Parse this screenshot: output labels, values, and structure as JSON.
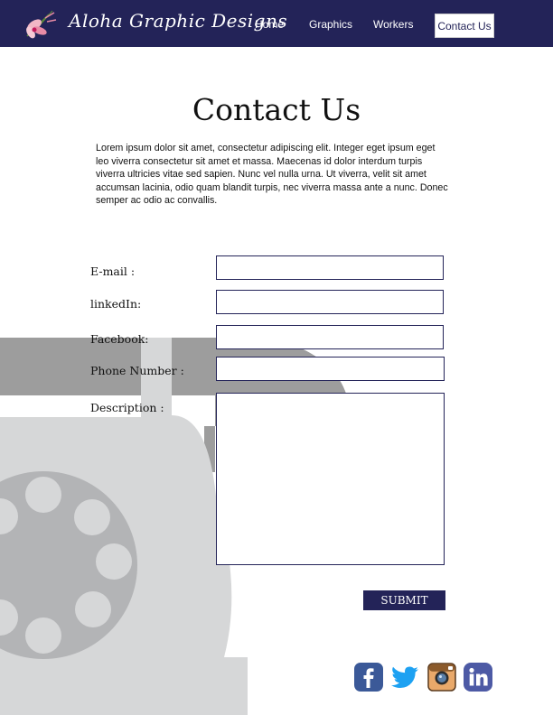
{
  "brand": {
    "name": "Aloha Graphic Designs"
  },
  "nav": {
    "items": [
      {
        "label": "Home"
      },
      {
        "label": "Graphics"
      },
      {
        "label": "Workers"
      },
      {
        "label": "Contact Us",
        "active": true
      }
    ]
  },
  "page": {
    "title": "Contact Us",
    "intro": "Lorem ipsum dolor sit amet, consectetur adipiscing elit. Integer eget ipsum eget leo viverra consectetur sit amet et massa. Maecenas id dolor interdum turpis viverra ultricies vitae sed sapien. Nunc vel nulla urna. Ut viverra, velit sit amet accumsan lacinia, odio quam blandit turpis, nec viverra massa ante a nunc. Donec semper ac odio ac convallis."
  },
  "form": {
    "email_label": "E-mail :",
    "linkedin_label": "linkedIn:",
    "facebook_label": "Facebook:",
    "phone_label": "Phone Number :",
    "description_label": "Description :",
    "submit_label": "SUBMIT"
  },
  "social": [
    {
      "icon": "facebook-icon"
    },
    {
      "icon": "twitter-icon"
    },
    {
      "icon": "instagram-icon"
    },
    {
      "icon": "linkedin-icon"
    }
  ],
  "colors": {
    "navy": "#232358",
    "phone_dark": "#9d9d9d",
    "phone_light": "#d6d7d8",
    "dial": "#b3b4b6",
    "facebook": "#3b5998",
    "twitter": "#1da1f2",
    "instagram": "#e9a96a",
    "linkedin": "#4d5aa5"
  }
}
